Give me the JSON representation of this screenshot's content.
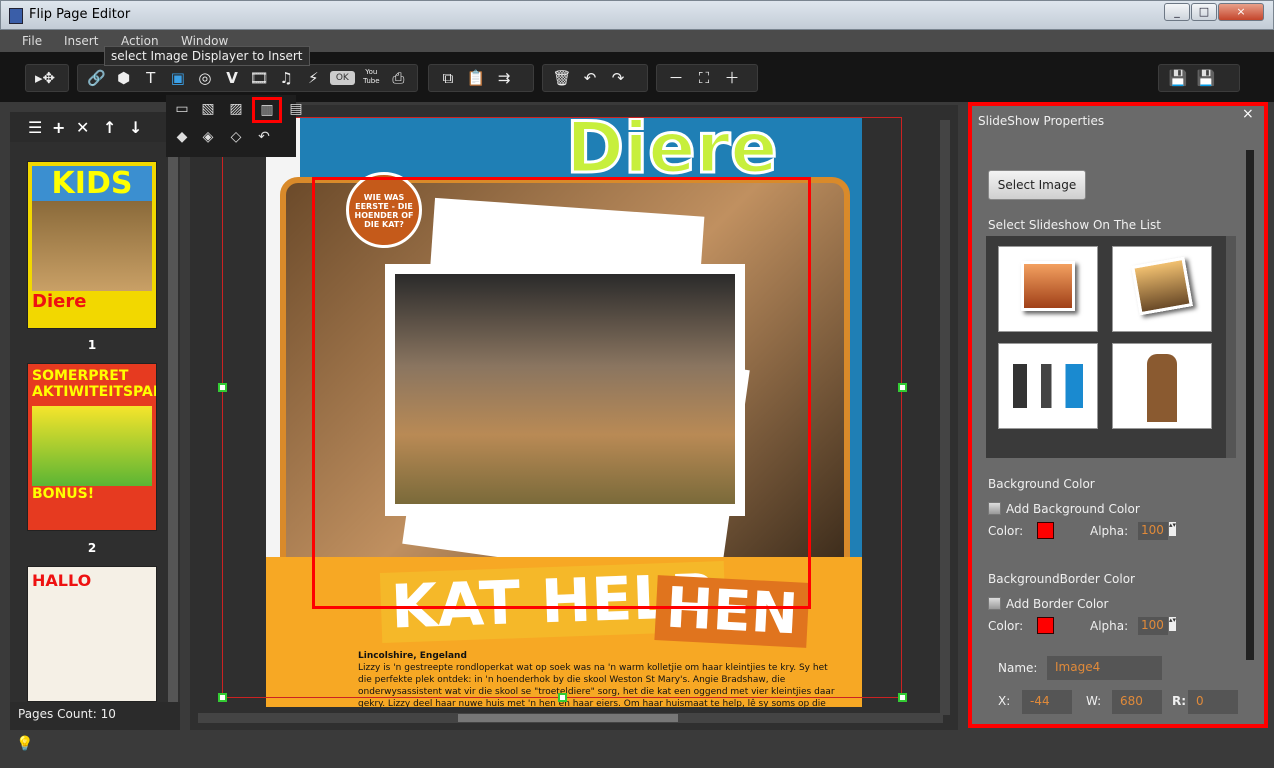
{
  "window": {
    "title": "Flip Page Editor",
    "controls": [
      "_",
      "□",
      "×"
    ]
  },
  "menu": [
    "File",
    "Insert",
    "Action",
    "Window"
  ],
  "tooltip": "select Image Displayer to Insert",
  "toolbar": {
    "select": [
      "▸✥"
    ],
    "insert": [
      "🔗",
      "⬢",
      "T",
      "▣",
      "◎",
      "V",
      "🎞",
      "♫",
      "⚡",
      "OK",
      "You Tube",
      "⎙"
    ],
    "edit": [
      "⧉",
      "📋",
      "⇉"
    ],
    "history": [
      "🗑",
      "↶",
      "↷"
    ],
    "zoom": [
      "－",
      "⛶",
      "＋"
    ],
    "save": [
      "💾",
      "💾"
    ]
  },
  "dropdown": {
    "row1": [
      "▭",
      "▧",
      "▨",
      "▥",
      "▤"
    ],
    "row2": [
      "◆",
      "◈",
      "◇",
      "↶"
    ],
    "selected_index": 3
  },
  "left_panel": {
    "tools": [
      "☰",
      "+",
      "✕",
      "↑",
      "↓"
    ],
    "pages": [
      {
        "number": "1",
        "cover_title": "KIDS",
        "cover_sub": "Diere"
      },
      {
        "number": "2",
        "cover_title": "SOMERPRET AKTIWITEITSPAK",
        "cover_sub": "BONUS!"
      },
      {
        "number": "",
        "cover_title": "HALLO",
        "cover_sub": ""
      }
    ],
    "pages_count": "Pages Count: 10"
  },
  "page_content": {
    "headline": "Diere",
    "bubble": "WIE WAS EERSTE - DIE HOENDER OF DIE KAT?",
    "title1": "KAT HELP",
    "title2": "HEN",
    "place": "Lincolshire, Engeland",
    "body": "Lizzy is 'n gestreepte rondloperkat wat op soek was na 'n warm kolletjie om haar kleintjies te kry. Sy het die perfekte plek ontdek: in 'n hoenderhok by die skool Weston St Mary's. Angie Bradshaw, die onderwysassistent wat vir die skool se \"troeteldiere\" sorg, het die kat een oggend met vier kleintjies daar gekry. Lizzy deel haar nuwe huis met 'n hen en haar eiers. Om haar huismaat te help, lê sy soms op die eiers sodat hulle kan warm bly. Die hen het eers gedink dis eienaardig,"
  },
  "properties": {
    "title": "SlideShow Properties",
    "close": "×",
    "select_image": "Select  Image",
    "list_label": "Select Slideshow On The List",
    "bg_section": "Background Color",
    "add_bg": "Add Background Color",
    "color_label": "Color:",
    "alpha_label": "Alpha:",
    "bg_alpha": "100",
    "border_section": "BackgroundBorder Color",
    "add_border": "Add Border Color",
    "border_alpha": "100",
    "name_label": "Name:",
    "name_value": "Image4",
    "x_label": "X:",
    "x_value": "-44",
    "w_label": "W:",
    "w_value": "680",
    "r_label": "R:",
    "r_value": "0",
    "colors": {
      "bg": "#ff0000",
      "border": "#ff0000",
      "highlight": "#ff0000"
    }
  }
}
